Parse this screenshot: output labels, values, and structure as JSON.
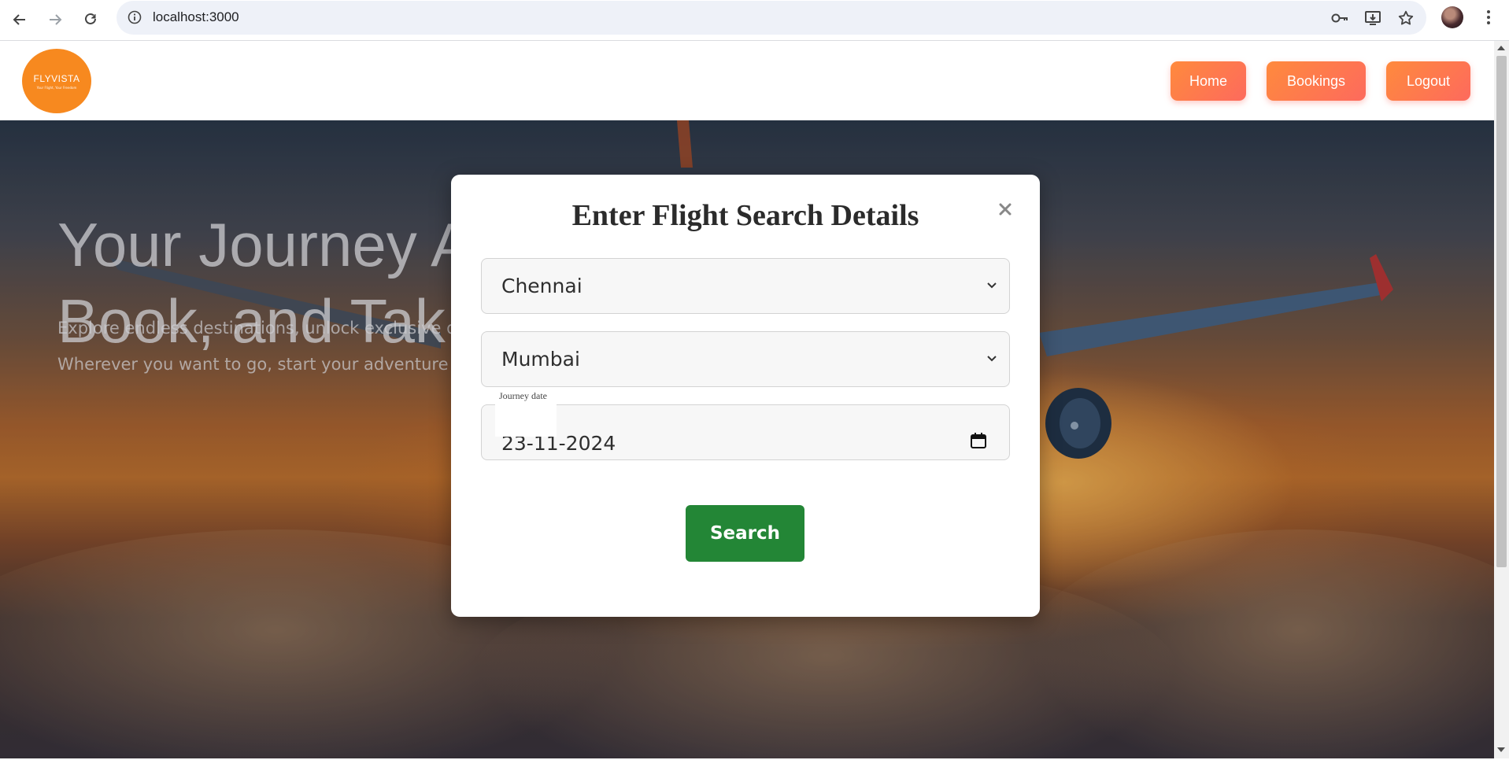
{
  "browser": {
    "url": "localhost:3000",
    "icons": [
      "back-icon",
      "forward-icon",
      "reload-icon",
      "site-info-icon",
      "password-key-icon",
      "install-app-icon",
      "bookmark-star-icon",
      "profile-avatar",
      "menu-icon"
    ]
  },
  "site": {
    "logo_name": "FLYVISTA",
    "logo_tagline": "Your Flight, Your Freedom",
    "nav": {
      "home": "Home",
      "bookings": "Bookings",
      "logout": "Logout"
    },
    "brand_color": "#f7891f",
    "nav_gradient": [
      "#ff8a3d",
      "#fd6a5d"
    ]
  },
  "hero": {
    "title_line1": "Your Journey A",
    "title_line2": "Book, and Tak",
    "subtitle1": "Explore endless destinations, unlock exclusive d",
    "subtitle2": "Wherever you want to go, start your adventure"
  },
  "modal": {
    "title": "Enter Flight Search Details",
    "from_value": "Chennai",
    "to_value": "Mumbai",
    "date_label": "Journey date",
    "date_value": "23-11-2024",
    "search_label": "Search",
    "search_color": "#238636"
  }
}
